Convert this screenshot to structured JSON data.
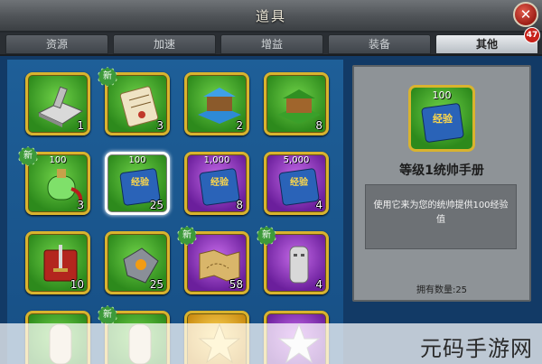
{
  "window": {
    "title": "道具",
    "close_symbol": "✕"
  },
  "tabs": [
    {
      "label": "资源",
      "active": false
    },
    {
      "label": "加速",
      "active": false
    },
    {
      "label": "增益",
      "active": false
    },
    {
      "label": "装备",
      "active": false
    },
    {
      "label": "其他",
      "active": true
    }
  ],
  "notification_badge": "47",
  "new_tag_text": "新",
  "items": [
    {
      "name": "anvil",
      "bg": "green",
      "label": "",
      "count": "1",
      "is_new": false
    },
    {
      "name": "scroll",
      "bg": "green",
      "label": "",
      "count": "3",
      "is_new": true
    },
    {
      "name": "blue-tent",
      "bg": "green",
      "label": "",
      "count": "2",
      "is_new": false
    },
    {
      "name": "green-building",
      "bg": "green",
      "label": "",
      "count": "8",
      "is_new": false
    },
    {
      "name": "green-potion",
      "bg": "green",
      "label": "100",
      "count": "3",
      "is_new": true
    },
    {
      "name": "exp-book-100",
      "bg": "green",
      "label": "100",
      "count": "25",
      "is_new": false,
      "selected": true
    },
    {
      "name": "exp-book-1000",
      "bg": "purple",
      "label": "1,000",
      "count": "8",
      "is_new": false
    },
    {
      "name": "exp-book-5000",
      "bg": "purple",
      "label": "5,000",
      "count": "4",
      "is_new": false
    },
    {
      "name": "red-book-sword",
      "bg": "green",
      "label": "",
      "count": "10",
      "is_new": false
    },
    {
      "name": "silver-shield",
      "bg": "green",
      "label": "",
      "count": "25",
      "is_new": false
    },
    {
      "name": "treasure-map",
      "bg": "purple",
      "label": "",
      "count": "58",
      "is_new": true
    },
    {
      "name": "stone-statue",
      "bg": "purple",
      "label": "",
      "count": "4",
      "is_new": true
    },
    {
      "name": "mummy-head",
      "bg": "green",
      "label": "",
      "count": "",
      "is_new": false
    },
    {
      "name": "mummy-body",
      "bg": "green",
      "label": "",
      "count": "",
      "is_new": true
    },
    {
      "name": "gold-star",
      "bg": "gold",
      "label": "",
      "count": "",
      "is_new": false
    },
    {
      "name": "silver-star",
      "bg": "purple",
      "label": "",
      "count": "",
      "is_new": false
    }
  ],
  "book_text": "经验",
  "detail": {
    "icon_label": "100",
    "name": "等级1统帅手册",
    "description": "使用它来为您的统帅提供100经验值",
    "quantity_text": "拥有数量:25"
  },
  "watermark": "元码手游网",
  "colors": {
    "accent_gold": "#d9b32e",
    "green_slot": "#4fb532",
    "purple_slot": "#8f3bc2",
    "badge_red": "#c8231b"
  }
}
